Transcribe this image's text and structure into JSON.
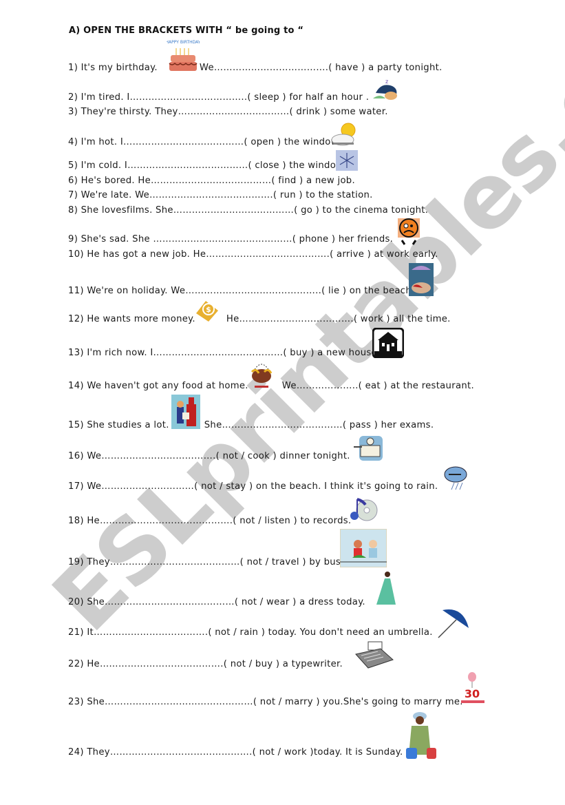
{
  "title": "A) OPEN THE BRACKETS WITH “ be going to “",
  "watermark": "ESLprintables.com",
  "exercises": [
    {
      "n": "1) It's my birthday.",
      "rest": "We……………………………….( have ) a party tonight.",
      "icon": "birthday-cake-icon"
    },
    {
      "n": "2) I'm tired. I………………………………..( sleep ) for half an hour .",
      "icon": "sleeping-icon"
    },
    {
      "n": "3) They're thirsty. They………………………………( drink ) some water."
    },
    {
      "n": "4) I'm hot. I…………………………………( open ) the window.",
      "icon": "sun-cloud-icon"
    },
    {
      "n": "5) I'm cold. I…………………………………( close ) the window.",
      "icon": "snowflake-icon"
    },
    {
      "n": "6) He's bored. He…………………………………( find ) a new job."
    },
    {
      "n": "7) We're late. We………………………………….( run ) to the station."
    },
    {
      "n": "8) She lovesfilms. She…………………………………( go ) to the cinema tonight."
    },
    {
      "n": "9) She's sad. She ………………………………………( phone ) her friends.",
      "icon": "sad-face-icon"
    },
    {
      "n": "10) He has got a new job. He………………………………….( arrive ) at work early.",
      "icon": "beach-umbrella-icon"
    },
    {
      "n": "11) We're on holiday. We……………………………………..( lie ) on the beach."
    },
    {
      "n": "12) He wants more money.",
      "rest": "He……………………………….( work ) all the time.",
      "icon": "money-icon"
    },
    {
      "n": "13) I'm rich now. I……………………………………( buy ) a new house.",
      "icon": "house-icon"
    },
    {
      "n": "14) We haven't got any food at home.",
      "rest": "We………………..( eat ) at the restaurant.",
      "icon": "food-basket-icon"
    },
    {
      "n": "15) She studies a lot.",
      "rest": "She…………………………………( pass ) her exams.",
      "icon": "diploma-icon"
    },
    {
      "n": "16) We……………………………….( not / cook ) dinner tonight.",
      "icon": "cooking-icon"
    },
    {
      "n": "17) We…………………………( not / stay ) on the beach. I think it's going to rain.",
      "icon": "rain-cloud-icon"
    },
    {
      "n": "18) He…………………………………….( not / listen ) to records.",
      "icon": "music-cd-icon"
    },
    {
      "n": "19) They……………………………………( not / travel ) by bus.",
      "icon": "bus-passengers-icon"
    },
    {
      "n": "20) She……………………………………( not / wear ) a dress today.",
      "icon": "dress-woman-icon"
    },
    {
      "n": "21) It……………………………….( not / rain ) today. You don't need an umbrella.",
      "icon": "umbrella-icon"
    },
    {
      "n": "22) He………………………………….( not / buy ) a typewriter.",
      "icon": "typewriter-icon"
    },
    {
      "n": "23) She…………………………………………( not / marry ) you.She's going to marry me.",
      "icon": "anniversary-icon"
    },
    {
      "n": "24) They……………………………………….( not / work )today. It is Sunday.",
      "icon": "worker-icon"
    }
  ],
  "clip_texts": {
    "birthday_banner": "HAPPY BIRTHDAY",
    "money_symbol": "$",
    "anniversary_number": "30"
  }
}
